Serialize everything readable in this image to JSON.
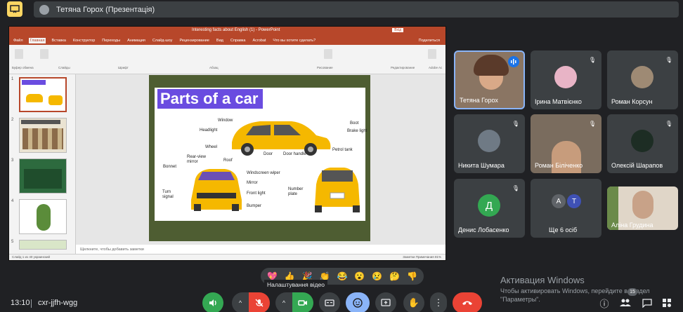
{
  "header": {
    "presenter_title": "Тетяна Горох (Презентація)"
  },
  "ppt": {
    "window_title": "Interesting facts about English (1) - PowerPoint",
    "sign_in": "Вхід",
    "tabs": [
      "Файл",
      "Главная",
      "Вставка",
      "Конструктор",
      "Переходы",
      "Анимация",
      "Слайд-шоу",
      "Рецензирование",
      "Вид",
      "Справка",
      "Acrobat",
      "Что вы хотите сделать?"
    ],
    "share": "Поделиться",
    "groups": [
      "Буфер обмена",
      "Слайды",
      "Шрифт",
      "Абзац",
      "Рисование",
      "Редактирование",
      "Adobe Ac"
    ],
    "notes_placeholder": "Щелкните, чтобы добавить заметки",
    "status_left": "Слайд 1 из 40   украинский",
    "status_right": "Заметки   Примечания   81%",
    "thumb_numbers": [
      "1",
      "2",
      "3",
      "4",
      "5"
    ],
    "slide_title": "Parts of a car",
    "car_labels": {
      "window": "Window",
      "headlight": "Headlight",
      "wheel": "Wheel",
      "door": "Door",
      "door_handle": "Door handle",
      "boot": "Boot",
      "brake_light": "Brake light",
      "petrol_tank": "Petrol tank",
      "bonnet": "Bonnet",
      "rear_view_mirror": "Rear-view\nmirror",
      "roof": "Roof",
      "windscreen_wiper": "Windscreen wiper",
      "mirror": "Mirror",
      "front_light": "Front light",
      "bumper": "Bumper",
      "turn_signal": "Turn\nsignal",
      "number_plate": "Number\nplate"
    }
  },
  "participants": [
    {
      "name": "Тетяна Горох",
      "speaking": true
    },
    {
      "name": "Ірина Матвієнко"
    },
    {
      "name": "Роман Корсун"
    },
    {
      "name": "Никита Шумара"
    },
    {
      "name": "Роман Біліченко"
    },
    {
      "name": "Олексій Шарапов"
    },
    {
      "name": "Денис Лобасенко",
      "initial": "Д"
    },
    {
      "name": "Ще 6 осіб",
      "initials": [
        "А",
        "Т"
      ]
    },
    {
      "name": "Аліна Грудина"
    }
  ],
  "reactions": [
    "💖",
    "👍",
    "🎉",
    "👏",
    "😂",
    "😮",
    "😢",
    "🤔",
    "👎"
  ],
  "tooltip": "Налаштування відео",
  "footer": {
    "time": "13:10",
    "meeting_code": "cxr-jjfh-wgg",
    "people_badge": "15"
  },
  "windows_activation": {
    "title": "Активация Windows",
    "subtitle": "Чтобы активировать Windows, перейдите в раздел \"Параметры\"."
  },
  "colors": {
    "background": "#202124",
    "tile": "#3c4043",
    "ppt_accent": "#b7472a",
    "end_call": "#ea4335",
    "mic_off": "#ea4335",
    "camera_on": "#34a853"
  }
}
